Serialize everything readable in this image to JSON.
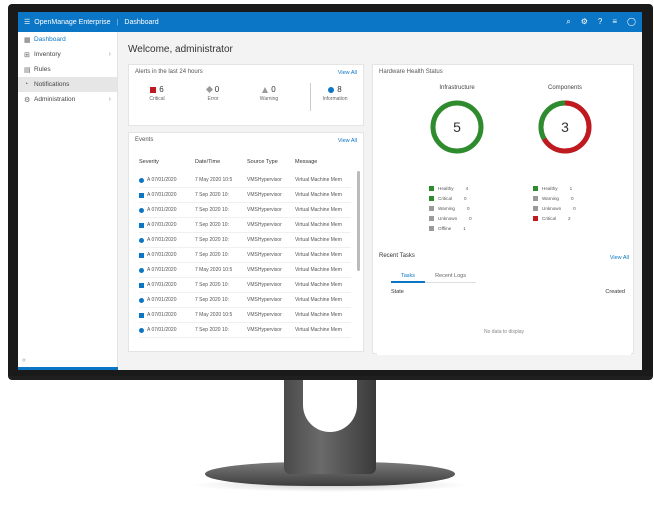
{
  "topbar": {
    "app_title": "OpenManage Enterprise",
    "page_label": "Dashboard"
  },
  "sidebar": {
    "items": [
      {
        "label": "Dashboard",
        "icon": "dashboard-icon",
        "has_children": false
      },
      {
        "label": "Inventory",
        "icon": "inventory-icon",
        "has_children": true
      },
      {
        "label": "Rules",
        "icon": "rules-icon",
        "has_children": false
      },
      {
        "label": "Notifications",
        "icon": "notification-icon",
        "has_children": false
      },
      {
        "label": "Administration",
        "icon": "admin-icon",
        "has_children": true
      }
    ]
  },
  "main": {
    "welcome": "Welcome, administrator",
    "alerts": {
      "title": "Alerts in the last 24 hours",
      "view_all": "View All",
      "items": [
        {
          "count": "6",
          "label": "Critical"
        },
        {
          "count": "0",
          "label": "Error"
        },
        {
          "count": "0",
          "label": "Warning"
        },
        {
          "count": "8",
          "label": "Information"
        }
      ]
    },
    "events": {
      "title": "Events",
      "view_all": "View All",
      "columns": [
        "Severity",
        "Date/Time",
        "Source Type",
        "Message"
      ],
      "rows": [
        [
          "A 07/01/2020",
          "7 May 2020 10:5",
          "VMSHypervisor",
          "Virtual Machine Mem"
        ],
        [
          "A 07/01/2020",
          "7 Sep 2020 10:",
          "VMSHypervisor",
          "Virtual Machine Mem"
        ],
        [
          "A 07/01/2020",
          "7 Sep 2020 10:",
          "VMSHypervisor",
          "Virtual Machine Mem"
        ],
        [
          "A 07/01/2020",
          "7 Sep 2020 10:",
          "VMSHypervisor",
          "Virtual Machine Mem"
        ],
        [
          "A 07/01/2020",
          "7 Sep 2020 10:",
          "VMSHypervisor",
          "Virtual Machine Mem"
        ],
        [
          "A 07/01/2020",
          "7 Sep 2020 10:",
          "VMSHypervisor",
          "Virtual Machine Mem"
        ],
        [
          "A 07/01/2020",
          "7 May 2020 10:5",
          "VMSHypervisor",
          "Virtual Machine Mem"
        ],
        [
          "A 07/01/2020",
          "7 Sep 2020 10:",
          "VMSHypervisor",
          "Virtual Machine Mem"
        ],
        [
          "A 07/01/2020",
          "7 Sep 2020 10:",
          "VMSHypervisor",
          "Virtual Machine Mem"
        ],
        [
          "A 07/01/2020",
          "7 May 2020 10:5",
          "VMSHypervisor",
          "Virtual Machine Mem"
        ],
        [
          "A 07/01/2020",
          "7 Sep 2020 10:",
          "VMSHypervisor",
          "Virtual Machine Mem"
        ]
      ]
    },
    "hardware": {
      "title": "Hardware Health Status",
      "infrastructure": {
        "title": "Infrastructure",
        "total": "5",
        "legend": [
          {
            "label": "Healthy",
            "value": "4",
            "color": "#2e8b2e"
          },
          {
            "label": "Critical",
            "value": "0",
            "color": "#2e8b2e"
          },
          {
            "label": "Warning",
            "value": "0",
            "color": "#9a9a9a"
          },
          {
            "label": "Unknown",
            "value": "0",
            "color": "#9a9a9a"
          },
          {
            "label": "Offline",
            "value": "1",
            "color": "#9a9a9a"
          }
        ],
        "ring_color": "#2e8b2e"
      },
      "components": {
        "title": "Components",
        "total": "3",
        "legend": [
          {
            "label": "Healthy",
            "value": "1",
            "color": "#2e8b2e"
          },
          {
            "label": "Warning",
            "value": "0",
            "color": "#9a9a9a"
          },
          {
            "label": "Unknown",
            "value": "0",
            "color": "#9a9a9a"
          },
          {
            "label": "Critical",
            "value": "2",
            "color": "#c0191f"
          }
        ],
        "ring_color": "#c0191f"
      }
    },
    "tasks": {
      "title": "Recent Tasks",
      "view_all": "View All",
      "tabs": [
        "Tasks",
        "Recent Logs"
      ],
      "col_left": "State",
      "col_right": "Created",
      "empty": "No data to display"
    }
  }
}
